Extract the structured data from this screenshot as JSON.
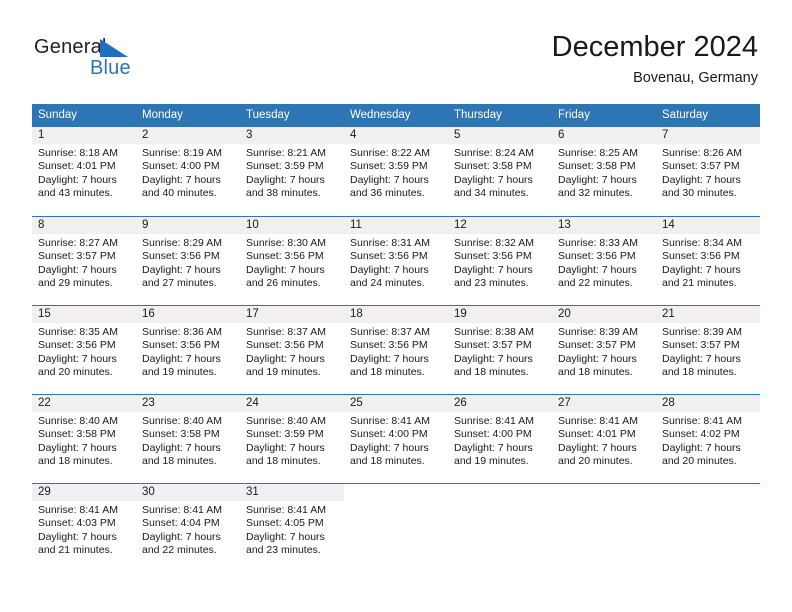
{
  "brand": {
    "name_part1": "General",
    "name_part2": "Blue",
    "color_dark": "#231F20",
    "color_blue": "#2E75B6"
  },
  "header": {
    "month_title": "December 2024",
    "location": "Bovenau, Germany"
  },
  "calendar": {
    "header_bg": "#2E75B6",
    "day_number_bg": "#F0F0F0",
    "weekdays": [
      "Sunday",
      "Monday",
      "Tuesday",
      "Wednesday",
      "Thursday",
      "Friday",
      "Saturday"
    ],
    "weeks": [
      [
        {
          "day": "1",
          "sunrise": "Sunrise: 8:18 AM",
          "sunset": "Sunset: 4:01 PM",
          "daylight_1": "Daylight: 7 hours",
          "daylight_2": "and 43 minutes."
        },
        {
          "day": "2",
          "sunrise": "Sunrise: 8:19 AM",
          "sunset": "Sunset: 4:00 PM",
          "daylight_1": "Daylight: 7 hours",
          "daylight_2": "and 40 minutes."
        },
        {
          "day": "3",
          "sunrise": "Sunrise: 8:21 AM",
          "sunset": "Sunset: 3:59 PM",
          "daylight_1": "Daylight: 7 hours",
          "daylight_2": "and 38 minutes."
        },
        {
          "day": "4",
          "sunrise": "Sunrise: 8:22 AM",
          "sunset": "Sunset: 3:59 PM",
          "daylight_1": "Daylight: 7 hours",
          "daylight_2": "and 36 minutes."
        },
        {
          "day": "5",
          "sunrise": "Sunrise: 8:24 AM",
          "sunset": "Sunset: 3:58 PM",
          "daylight_1": "Daylight: 7 hours",
          "daylight_2": "and 34 minutes."
        },
        {
          "day": "6",
          "sunrise": "Sunrise: 8:25 AM",
          "sunset": "Sunset: 3:58 PM",
          "daylight_1": "Daylight: 7 hours",
          "daylight_2": "and 32 minutes."
        },
        {
          "day": "7",
          "sunrise": "Sunrise: 8:26 AM",
          "sunset": "Sunset: 3:57 PM",
          "daylight_1": "Daylight: 7 hours",
          "daylight_2": "and 30 minutes."
        }
      ],
      [
        {
          "day": "8",
          "sunrise": "Sunrise: 8:27 AM",
          "sunset": "Sunset: 3:57 PM",
          "daylight_1": "Daylight: 7 hours",
          "daylight_2": "and 29 minutes."
        },
        {
          "day": "9",
          "sunrise": "Sunrise: 8:29 AM",
          "sunset": "Sunset: 3:56 PM",
          "daylight_1": "Daylight: 7 hours",
          "daylight_2": "and 27 minutes."
        },
        {
          "day": "10",
          "sunrise": "Sunrise: 8:30 AM",
          "sunset": "Sunset: 3:56 PM",
          "daylight_1": "Daylight: 7 hours",
          "daylight_2": "and 26 minutes."
        },
        {
          "day": "11",
          "sunrise": "Sunrise: 8:31 AM",
          "sunset": "Sunset: 3:56 PM",
          "daylight_1": "Daylight: 7 hours",
          "daylight_2": "and 24 minutes."
        },
        {
          "day": "12",
          "sunrise": "Sunrise: 8:32 AM",
          "sunset": "Sunset: 3:56 PM",
          "daylight_1": "Daylight: 7 hours",
          "daylight_2": "and 23 minutes."
        },
        {
          "day": "13",
          "sunrise": "Sunrise: 8:33 AM",
          "sunset": "Sunset: 3:56 PM",
          "daylight_1": "Daylight: 7 hours",
          "daylight_2": "and 22 minutes."
        },
        {
          "day": "14",
          "sunrise": "Sunrise: 8:34 AM",
          "sunset": "Sunset: 3:56 PM",
          "daylight_1": "Daylight: 7 hours",
          "daylight_2": "and 21 minutes."
        }
      ],
      [
        {
          "day": "15",
          "sunrise": "Sunrise: 8:35 AM",
          "sunset": "Sunset: 3:56 PM",
          "daylight_1": "Daylight: 7 hours",
          "daylight_2": "and 20 minutes."
        },
        {
          "day": "16",
          "sunrise": "Sunrise: 8:36 AM",
          "sunset": "Sunset: 3:56 PM",
          "daylight_1": "Daylight: 7 hours",
          "daylight_2": "and 19 minutes."
        },
        {
          "day": "17",
          "sunrise": "Sunrise: 8:37 AM",
          "sunset": "Sunset: 3:56 PM",
          "daylight_1": "Daylight: 7 hours",
          "daylight_2": "and 19 minutes."
        },
        {
          "day": "18",
          "sunrise": "Sunrise: 8:37 AM",
          "sunset": "Sunset: 3:56 PM",
          "daylight_1": "Daylight: 7 hours",
          "daylight_2": "and 18 minutes."
        },
        {
          "day": "19",
          "sunrise": "Sunrise: 8:38 AM",
          "sunset": "Sunset: 3:57 PM",
          "daylight_1": "Daylight: 7 hours",
          "daylight_2": "and 18 minutes."
        },
        {
          "day": "20",
          "sunrise": "Sunrise: 8:39 AM",
          "sunset": "Sunset: 3:57 PM",
          "daylight_1": "Daylight: 7 hours",
          "daylight_2": "and 18 minutes."
        },
        {
          "day": "21",
          "sunrise": "Sunrise: 8:39 AM",
          "sunset": "Sunset: 3:57 PM",
          "daylight_1": "Daylight: 7 hours",
          "daylight_2": "and 18 minutes."
        }
      ],
      [
        {
          "day": "22",
          "sunrise": "Sunrise: 8:40 AM",
          "sunset": "Sunset: 3:58 PM",
          "daylight_1": "Daylight: 7 hours",
          "daylight_2": "and 18 minutes."
        },
        {
          "day": "23",
          "sunrise": "Sunrise: 8:40 AM",
          "sunset": "Sunset: 3:58 PM",
          "daylight_1": "Daylight: 7 hours",
          "daylight_2": "and 18 minutes."
        },
        {
          "day": "24",
          "sunrise": "Sunrise: 8:40 AM",
          "sunset": "Sunset: 3:59 PM",
          "daylight_1": "Daylight: 7 hours",
          "daylight_2": "and 18 minutes."
        },
        {
          "day": "25",
          "sunrise": "Sunrise: 8:41 AM",
          "sunset": "Sunset: 4:00 PM",
          "daylight_1": "Daylight: 7 hours",
          "daylight_2": "and 18 minutes."
        },
        {
          "day": "26",
          "sunrise": "Sunrise: 8:41 AM",
          "sunset": "Sunset: 4:00 PM",
          "daylight_1": "Daylight: 7 hours",
          "daylight_2": "and 19 minutes."
        },
        {
          "day": "27",
          "sunrise": "Sunrise: 8:41 AM",
          "sunset": "Sunset: 4:01 PM",
          "daylight_1": "Daylight: 7 hours",
          "daylight_2": "and 20 minutes."
        },
        {
          "day": "28",
          "sunrise": "Sunrise: 8:41 AM",
          "sunset": "Sunset: 4:02 PM",
          "daylight_1": "Daylight: 7 hours",
          "daylight_2": "and 20 minutes."
        }
      ],
      [
        {
          "day": "29",
          "sunrise": "Sunrise: 8:41 AM",
          "sunset": "Sunset: 4:03 PM",
          "daylight_1": "Daylight: 7 hours",
          "daylight_2": "and 21 minutes."
        },
        {
          "day": "30",
          "sunrise": "Sunrise: 8:41 AM",
          "sunset": "Sunset: 4:04 PM",
          "daylight_1": "Daylight: 7 hours",
          "daylight_2": "and 22 minutes."
        },
        {
          "day": "31",
          "sunrise": "Sunrise: 8:41 AM",
          "sunset": "Sunset: 4:05 PM",
          "daylight_1": "Daylight: 7 hours",
          "daylight_2": "and 23 minutes."
        },
        {
          "day": "",
          "sunrise": "",
          "sunset": "",
          "daylight_1": "",
          "daylight_2": ""
        },
        {
          "day": "",
          "sunrise": "",
          "sunset": "",
          "daylight_1": "",
          "daylight_2": ""
        },
        {
          "day": "",
          "sunrise": "",
          "sunset": "",
          "daylight_1": "",
          "daylight_2": ""
        },
        {
          "day": "",
          "sunrise": "",
          "sunset": "",
          "daylight_1": "",
          "daylight_2": ""
        }
      ]
    ]
  }
}
